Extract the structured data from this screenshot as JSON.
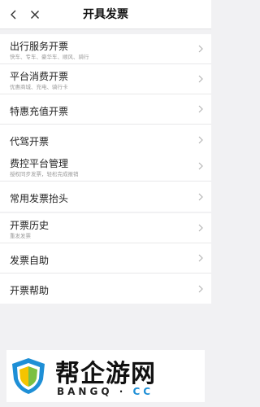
{
  "header": {
    "title": "开具发票",
    "back_icon": "chevron-left-icon",
    "close_icon": "close-icon"
  },
  "groups": [
    {
      "items": [
        {
          "title": "出行服务开票",
          "subtitle": "快车、专车、豪华车、顺风、骑行"
        },
        {
          "title": "平台消费开票",
          "subtitle": "优惠商城、充电、骑行卡"
        },
        {
          "title": "特惠充值开票"
        },
        {
          "title": "代驾开票"
        }
      ]
    },
    {
      "items": [
        {
          "title": "费控平台管理",
          "subtitle": "授权同步发票，轻松完成报销"
        },
        {
          "title": "常用发票抬头"
        }
      ]
    },
    {
      "items": [
        {
          "title": "开票历史",
          "subtitle": "重发发票"
        },
        {
          "title": "发票自助"
        },
        {
          "title": "开票帮助"
        }
      ]
    }
  ],
  "watermark": {
    "brand": "帮企游网",
    "domain_main": "BANGQ",
    "domain_sep": " · ",
    "domain_tld": "CC",
    "colors": {
      "shield_blue": "#1e8fd6",
      "shield_green": "#7bc043",
      "shield_yellow": "#f5c400"
    }
  }
}
